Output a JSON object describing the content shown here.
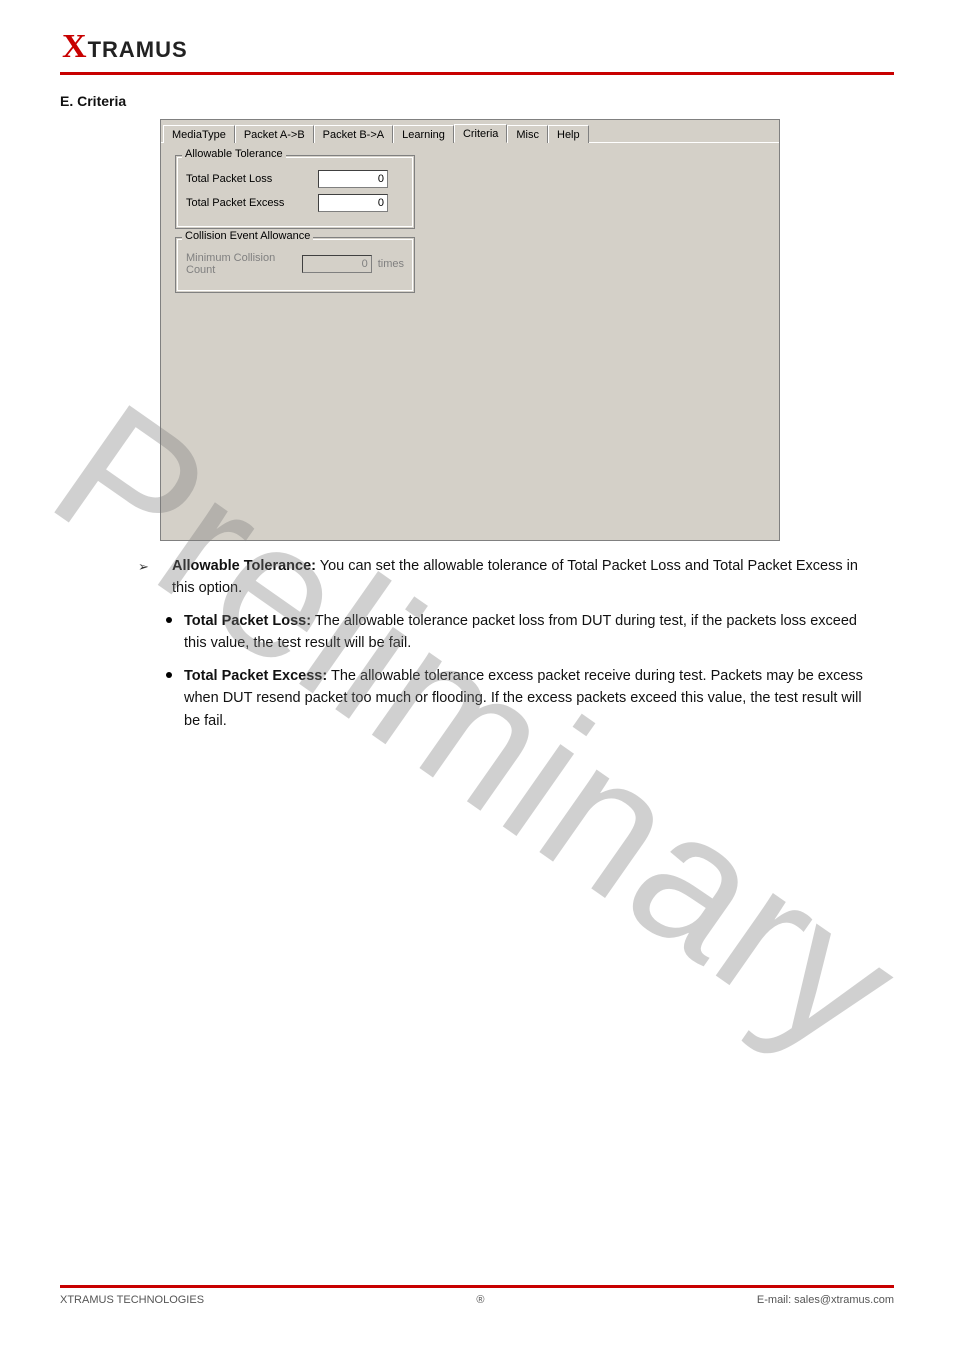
{
  "logo": {
    "x": "X",
    "rest": "TRAMUS"
  },
  "heading": "E. Criteria",
  "dialog": {
    "tabs": [
      "MediaType",
      "Packet A->B",
      "Packet B->A",
      "Learning",
      "Criteria",
      "Misc",
      "Help"
    ],
    "active_tab_index": 4,
    "group1": {
      "title": "Allowable Tolerance",
      "rows": [
        {
          "label": "Total Packet Loss",
          "value": "0"
        },
        {
          "label": "Total Packet Excess",
          "value": "0"
        }
      ]
    },
    "group2": {
      "title": "Collision Event Allowance",
      "row": {
        "label": "Minimum Collision Count",
        "value": "0",
        "unit": "times"
      }
    }
  },
  "body": {
    "arrow_label_bold": "Allowable Tolerance:",
    "arrow_label_rest": " You can set the allowable tolerance of Total Packet Loss and Total Packet Excess in this option.",
    "b1_bold": "Total Packet Loss:",
    "b1_rest": " The allowable tolerance packet loss from DUT during test, if the packets loss exceed this value, the test result will be fail.",
    "b2_bold": "Total Packet Excess:",
    "b2_rest": " The allowable tolerance excess packet receive during test. Packets may be excess when DUT resend packet too much or flooding. If the excess packets exceed this value, the test result will be fail."
  },
  "footer": {
    "left": "XTRAMUS TECHNOLOGIES",
    "center": "®",
    "right": "E-mail: sales@xtramus.com"
  }
}
